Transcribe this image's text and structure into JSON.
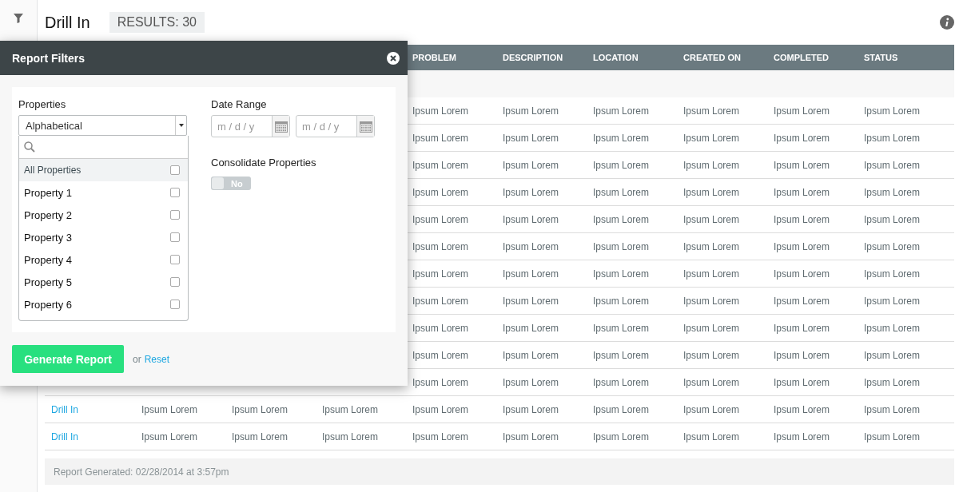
{
  "header": {
    "title": "Drill In",
    "results": "RESULTS: 30"
  },
  "table": {
    "columns": [
      null,
      null,
      null,
      null,
      "PROBLEM",
      "DESCRIPTION",
      "LOCATION",
      "CREATED ON",
      "COMPLETED",
      "STATUS"
    ],
    "rows": [
      {
        "cells": [
          null,
          null,
          null,
          null,
          "Ipsum Lorem",
          "Ipsum Lorem",
          "Ipsum Lorem",
          "Ipsum Lorem",
          "Ipsum Lorem",
          "Ipsum Lorem"
        ]
      },
      {
        "cells": [
          null,
          null,
          null,
          null,
          "Ipsum Lorem",
          "Ipsum Lorem",
          "Ipsum Lorem",
          "Ipsum Lorem",
          "Ipsum Lorem",
          "Ipsum Lorem"
        ]
      },
      {
        "cells": [
          null,
          null,
          null,
          null,
          "Ipsum Lorem",
          "Ipsum Lorem",
          "Ipsum Lorem",
          "Ipsum Lorem",
          "Ipsum Lorem",
          "Ipsum Lorem"
        ]
      },
      {
        "cells": [
          null,
          null,
          null,
          null,
          "Ipsum Lorem",
          "Ipsum Lorem",
          "Ipsum Lorem",
          "Ipsum Lorem",
          "Ipsum Lorem",
          "Ipsum Lorem"
        ]
      },
      {
        "cells": [
          null,
          null,
          null,
          null,
          "Ipsum Lorem",
          "Ipsum Lorem",
          "Ipsum Lorem",
          "Ipsum Lorem",
          "Ipsum Lorem",
          "Ipsum Lorem"
        ]
      },
      {
        "cells": [
          null,
          null,
          null,
          null,
          "Ipsum Lorem",
          "Ipsum Lorem",
          "Ipsum Lorem",
          "Ipsum Lorem",
          "Ipsum Lorem",
          "Ipsum Lorem"
        ]
      },
      {
        "cells": [
          null,
          null,
          null,
          null,
          "Ipsum Lorem",
          "Ipsum Lorem",
          "Ipsum Lorem",
          "Ipsum Lorem",
          "Ipsum Lorem",
          "Ipsum Lorem"
        ]
      },
      {
        "cells": [
          null,
          null,
          null,
          null,
          "Ipsum Lorem",
          "Ipsum Lorem",
          "Ipsum Lorem",
          "Ipsum Lorem",
          "Ipsum Lorem",
          "Ipsum Lorem"
        ]
      },
      {
        "cells": [
          null,
          null,
          null,
          null,
          "Ipsum Lorem",
          "Ipsum Lorem",
          "Ipsum Lorem",
          "Ipsum Lorem",
          "Ipsum Lorem",
          "Ipsum Lorem"
        ]
      },
      {
        "cells": [
          null,
          null,
          null,
          null,
          "Ipsum Lorem",
          "Ipsum Lorem",
          "Ipsum Lorem",
          "Ipsum Lorem",
          "Ipsum Lorem",
          "Ipsum Lorem"
        ]
      },
      {
        "cells": [
          null,
          null,
          null,
          null,
          "Ipsum Lorem",
          "Ipsum Lorem",
          "Ipsum Lorem",
          "Ipsum Lorem",
          "Ipsum Lorem",
          "Ipsum Lorem"
        ]
      },
      {
        "cells": [
          "Drill In",
          "Ipsum Lorem",
          "Ipsum Lorem",
          "Ipsum Lorem",
          "Ipsum Lorem",
          "Ipsum Lorem",
          "Ipsum Lorem",
          "Ipsum Lorem",
          "Ipsum Lorem",
          "Ipsum Lorem"
        ]
      },
      {
        "cells": [
          "Drill In",
          "Ipsum Lorem",
          "Ipsum Lorem",
          "Ipsum Lorem",
          "Ipsum Lorem",
          "Ipsum Lorem",
          "Ipsum Lorem",
          "Ipsum Lorem",
          "Ipsum Lorem",
          "Ipsum Lorem"
        ]
      }
    ]
  },
  "footer": "Report Generated: 02/28/2014 at 3:57pm",
  "filters": {
    "title": "Report Filters",
    "properties": {
      "label": "Properties",
      "sort": "Alphabetical",
      "items": [
        {
          "label": "All Properties",
          "checked": false,
          "selected": true
        },
        {
          "label": "Property 1",
          "checked": false,
          "selected": false
        },
        {
          "label": "Property 2",
          "checked": false,
          "selected": false
        },
        {
          "label": "Property 3",
          "checked": false,
          "selected": false
        },
        {
          "label": "Property 4",
          "checked": false,
          "selected": false
        },
        {
          "label": "Property 5",
          "checked": false,
          "selected": false
        },
        {
          "label": "Property 6",
          "checked": false,
          "selected": false
        }
      ]
    },
    "date_range": {
      "label": "Date Range",
      "from_placeholder": "m / d / y",
      "to_placeholder": "m / d / y"
    },
    "consolidate": {
      "label": "Consolidate Properties",
      "on": false,
      "state_label": "No"
    },
    "generate": "Generate Report",
    "or": "or",
    "reset": "Reset"
  }
}
